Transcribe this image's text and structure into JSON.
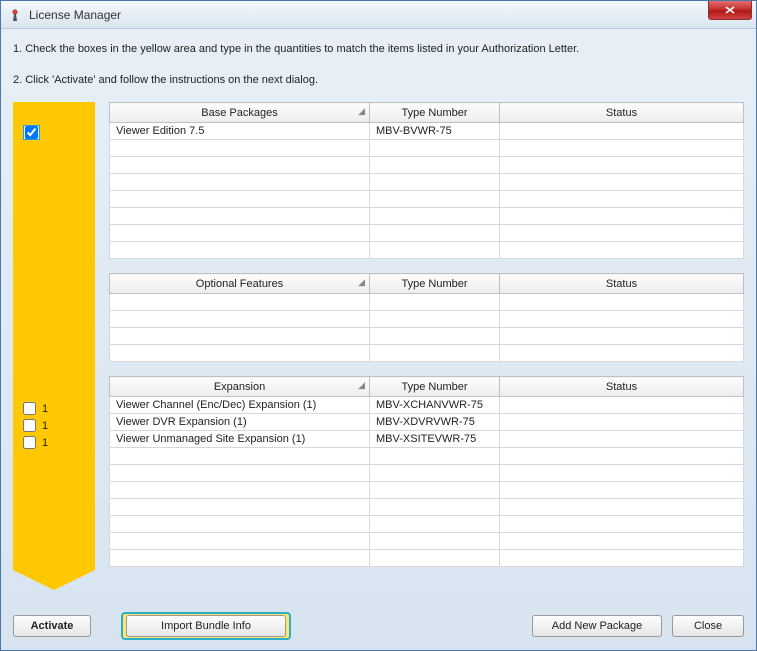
{
  "window": {
    "title": "License Manager"
  },
  "instructions": {
    "line1": "1. Check the boxes in the yellow area and type in the quantities to match the items listed in your Authorization Letter.",
    "line2": "2. Click  'Activate' and follow the instructions on the next dialog."
  },
  "tables": {
    "base": {
      "headers": {
        "col1": "Base Packages",
        "col2": "Type Number",
        "col3": "Status"
      },
      "rows": [
        {
          "checked": true,
          "qty": "",
          "name": "Viewer Edition 7.5",
          "type": "MBV-BVWR-75",
          "status": ""
        }
      ],
      "emptyRows": 7
    },
    "optional": {
      "headers": {
        "col1": "Optional Features",
        "col2": "Type Number",
        "col3": "Status"
      },
      "rows": [],
      "emptyRows": 4
    },
    "expansion": {
      "headers": {
        "col1": "Expansion",
        "col2": "Type Number",
        "col3": "Status"
      },
      "rows": [
        {
          "checked": false,
          "qty": "1",
          "name": "Viewer Channel (Enc/Dec) Expansion (1)",
          "type": "MBV-XCHANVWR-75",
          "status": ""
        },
        {
          "checked": false,
          "qty": "1",
          "name": "Viewer DVR Expansion (1)",
          "type": "MBV-XDVRVWR-75",
          "status": ""
        },
        {
          "checked": false,
          "qty": "1",
          "name": "Viewer Unmanaged Site Expansion (1)",
          "type": "MBV-XSITEVWR-75",
          "status": ""
        }
      ],
      "emptyRows": 7
    }
  },
  "buttons": {
    "activate": "Activate",
    "importBundle": "Import Bundle Info",
    "addPackage": "Add New Package",
    "close": "Close"
  }
}
